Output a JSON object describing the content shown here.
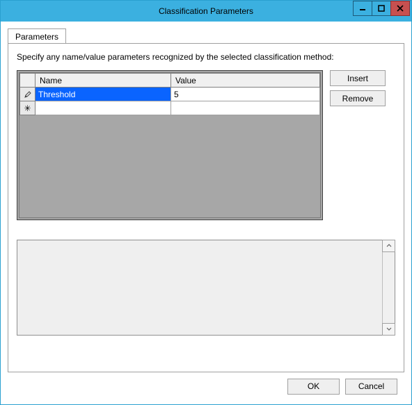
{
  "titlebar": {
    "title": "Classification Parameters",
    "min_tooltip": "Minimize",
    "max_tooltip": "Maximize",
    "close_tooltip": "Close"
  },
  "tabs": {
    "parameters_label": "Parameters"
  },
  "panel": {
    "description": "Specify any name/value parameters recognized by the selected classification method:"
  },
  "grid": {
    "headers": {
      "selector": "",
      "name": "Name",
      "value": "Value"
    },
    "rows": [
      {
        "selector_icon": "edit",
        "name": "Threshold",
        "value": "5",
        "selected": true,
        "editing": true
      },
      {
        "selector_icon": "new",
        "name": "",
        "value": "",
        "selected": false,
        "editing": false
      }
    ]
  },
  "buttons": {
    "insert": "Insert",
    "remove": "Remove",
    "ok": "OK",
    "cancel": "Cancel"
  }
}
